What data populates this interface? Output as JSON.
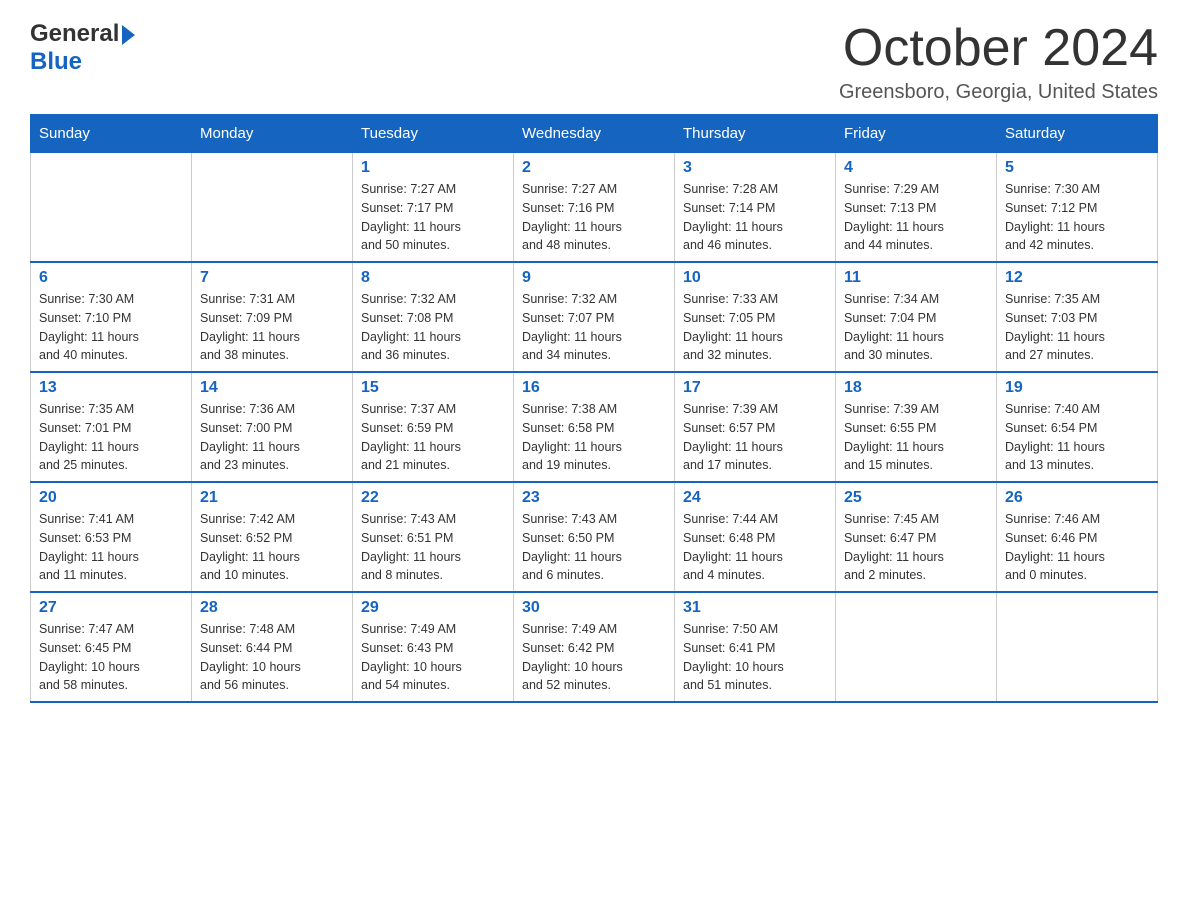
{
  "header": {
    "logo_general": "General",
    "logo_blue": "Blue",
    "month_year": "October 2024",
    "location": "Greensboro, Georgia, United States"
  },
  "weekdays": [
    "Sunday",
    "Monday",
    "Tuesday",
    "Wednesday",
    "Thursday",
    "Friday",
    "Saturday"
  ],
  "weeks": [
    [
      {
        "day": "",
        "info": ""
      },
      {
        "day": "",
        "info": ""
      },
      {
        "day": "1",
        "info": "Sunrise: 7:27 AM\nSunset: 7:17 PM\nDaylight: 11 hours\nand 50 minutes."
      },
      {
        "day": "2",
        "info": "Sunrise: 7:27 AM\nSunset: 7:16 PM\nDaylight: 11 hours\nand 48 minutes."
      },
      {
        "day": "3",
        "info": "Sunrise: 7:28 AM\nSunset: 7:14 PM\nDaylight: 11 hours\nand 46 minutes."
      },
      {
        "day": "4",
        "info": "Sunrise: 7:29 AM\nSunset: 7:13 PM\nDaylight: 11 hours\nand 44 minutes."
      },
      {
        "day": "5",
        "info": "Sunrise: 7:30 AM\nSunset: 7:12 PM\nDaylight: 11 hours\nand 42 minutes."
      }
    ],
    [
      {
        "day": "6",
        "info": "Sunrise: 7:30 AM\nSunset: 7:10 PM\nDaylight: 11 hours\nand 40 minutes."
      },
      {
        "day": "7",
        "info": "Sunrise: 7:31 AM\nSunset: 7:09 PM\nDaylight: 11 hours\nand 38 minutes."
      },
      {
        "day": "8",
        "info": "Sunrise: 7:32 AM\nSunset: 7:08 PM\nDaylight: 11 hours\nand 36 minutes."
      },
      {
        "day": "9",
        "info": "Sunrise: 7:32 AM\nSunset: 7:07 PM\nDaylight: 11 hours\nand 34 minutes."
      },
      {
        "day": "10",
        "info": "Sunrise: 7:33 AM\nSunset: 7:05 PM\nDaylight: 11 hours\nand 32 minutes."
      },
      {
        "day": "11",
        "info": "Sunrise: 7:34 AM\nSunset: 7:04 PM\nDaylight: 11 hours\nand 30 minutes."
      },
      {
        "day": "12",
        "info": "Sunrise: 7:35 AM\nSunset: 7:03 PM\nDaylight: 11 hours\nand 27 minutes."
      }
    ],
    [
      {
        "day": "13",
        "info": "Sunrise: 7:35 AM\nSunset: 7:01 PM\nDaylight: 11 hours\nand 25 minutes."
      },
      {
        "day": "14",
        "info": "Sunrise: 7:36 AM\nSunset: 7:00 PM\nDaylight: 11 hours\nand 23 minutes."
      },
      {
        "day": "15",
        "info": "Sunrise: 7:37 AM\nSunset: 6:59 PM\nDaylight: 11 hours\nand 21 minutes."
      },
      {
        "day": "16",
        "info": "Sunrise: 7:38 AM\nSunset: 6:58 PM\nDaylight: 11 hours\nand 19 minutes."
      },
      {
        "day": "17",
        "info": "Sunrise: 7:39 AM\nSunset: 6:57 PM\nDaylight: 11 hours\nand 17 minutes."
      },
      {
        "day": "18",
        "info": "Sunrise: 7:39 AM\nSunset: 6:55 PM\nDaylight: 11 hours\nand 15 minutes."
      },
      {
        "day": "19",
        "info": "Sunrise: 7:40 AM\nSunset: 6:54 PM\nDaylight: 11 hours\nand 13 minutes."
      }
    ],
    [
      {
        "day": "20",
        "info": "Sunrise: 7:41 AM\nSunset: 6:53 PM\nDaylight: 11 hours\nand 11 minutes."
      },
      {
        "day": "21",
        "info": "Sunrise: 7:42 AM\nSunset: 6:52 PM\nDaylight: 11 hours\nand 10 minutes."
      },
      {
        "day": "22",
        "info": "Sunrise: 7:43 AM\nSunset: 6:51 PM\nDaylight: 11 hours\nand 8 minutes."
      },
      {
        "day": "23",
        "info": "Sunrise: 7:43 AM\nSunset: 6:50 PM\nDaylight: 11 hours\nand 6 minutes."
      },
      {
        "day": "24",
        "info": "Sunrise: 7:44 AM\nSunset: 6:48 PM\nDaylight: 11 hours\nand 4 minutes."
      },
      {
        "day": "25",
        "info": "Sunrise: 7:45 AM\nSunset: 6:47 PM\nDaylight: 11 hours\nand 2 minutes."
      },
      {
        "day": "26",
        "info": "Sunrise: 7:46 AM\nSunset: 6:46 PM\nDaylight: 11 hours\nand 0 minutes."
      }
    ],
    [
      {
        "day": "27",
        "info": "Sunrise: 7:47 AM\nSunset: 6:45 PM\nDaylight: 10 hours\nand 58 minutes."
      },
      {
        "day": "28",
        "info": "Sunrise: 7:48 AM\nSunset: 6:44 PM\nDaylight: 10 hours\nand 56 minutes."
      },
      {
        "day": "29",
        "info": "Sunrise: 7:49 AM\nSunset: 6:43 PM\nDaylight: 10 hours\nand 54 minutes."
      },
      {
        "day": "30",
        "info": "Sunrise: 7:49 AM\nSunset: 6:42 PM\nDaylight: 10 hours\nand 52 minutes."
      },
      {
        "day": "31",
        "info": "Sunrise: 7:50 AM\nSunset: 6:41 PM\nDaylight: 10 hours\nand 51 minutes."
      },
      {
        "day": "",
        "info": ""
      },
      {
        "day": "",
        "info": ""
      }
    ]
  ]
}
